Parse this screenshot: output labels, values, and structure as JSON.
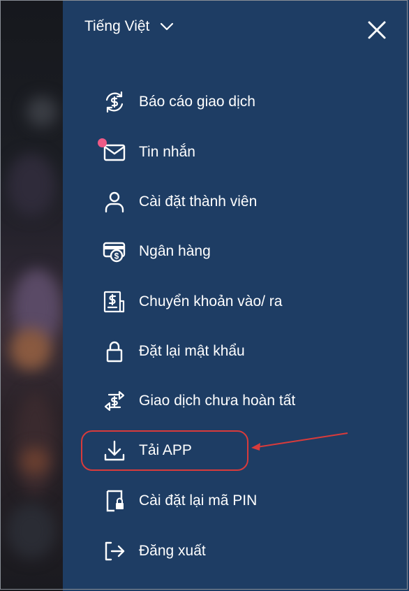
{
  "header": {
    "language": "Tiếng Việt"
  },
  "menu": {
    "items": [
      {
        "label": "Báo cáo giao dịch",
        "icon": "transaction-report-icon"
      },
      {
        "label": "Tin nhắn",
        "icon": "mail-icon"
      },
      {
        "label": "Cài đặt thành viên",
        "icon": "user-icon"
      },
      {
        "label": "Ngân hàng",
        "icon": "bank-card-icon"
      },
      {
        "label": "Chuyển khoản vào/ ra",
        "icon": "transfer-icon"
      },
      {
        "label": "Đặt lại mật khẩu",
        "icon": "lock-icon"
      },
      {
        "label": "Giao dịch chưa hoàn tất",
        "icon": "pending-transaction-icon"
      },
      {
        "label": "Tải APP",
        "icon": "download-icon"
      },
      {
        "label": "Cài đặt lại mã PIN",
        "icon": "pin-lock-icon"
      },
      {
        "label": "Đăng xuất",
        "icon": "logout-icon"
      }
    ]
  },
  "colors": {
    "panel": "#1e3d64",
    "text": "#ffffff",
    "notification_dot": "#ef5a86",
    "annotation": "#d93b3b"
  }
}
